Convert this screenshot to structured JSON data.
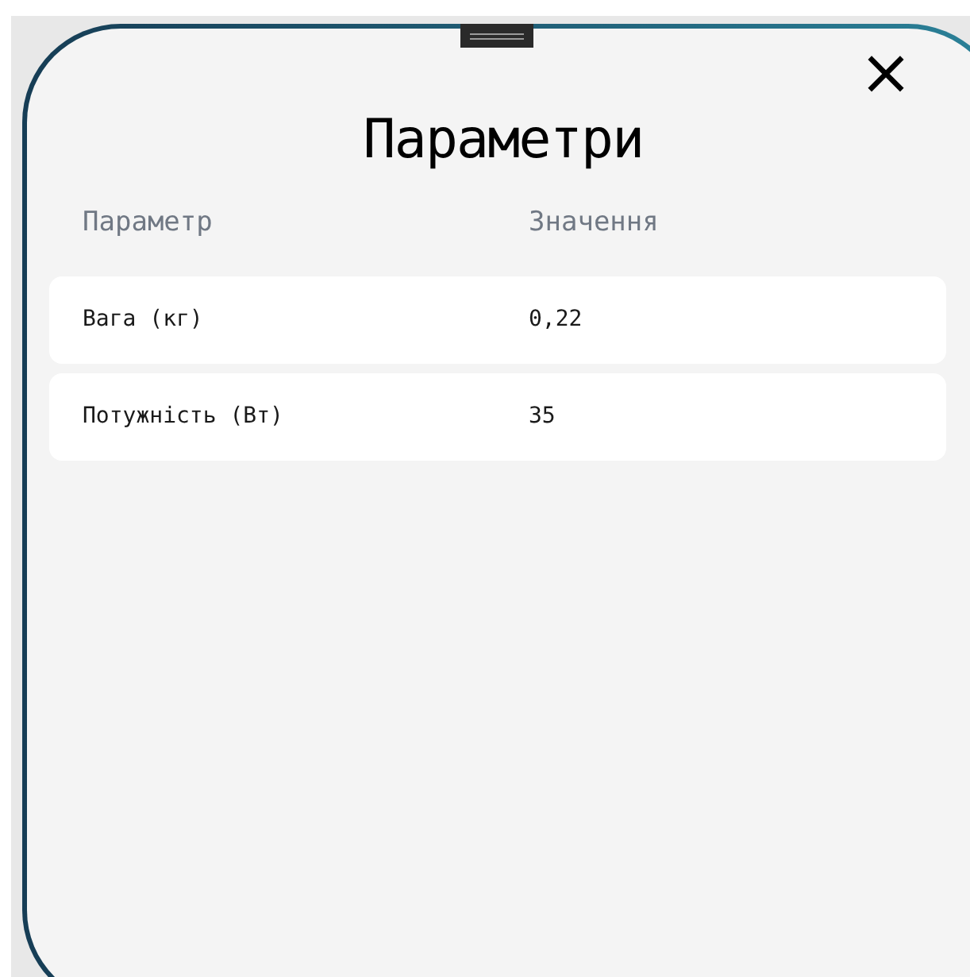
{
  "dialog": {
    "title": "Параметри",
    "close": "×"
  },
  "table": {
    "columns": [
      "Параметр",
      "Значення"
    ],
    "rows": [
      {
        "name": "Вага (кг)",
        "value": "0,22"
      },
      {
        "name": "Потужність (Вт)",
        "value": "35"
      }
    ]
  }
}
